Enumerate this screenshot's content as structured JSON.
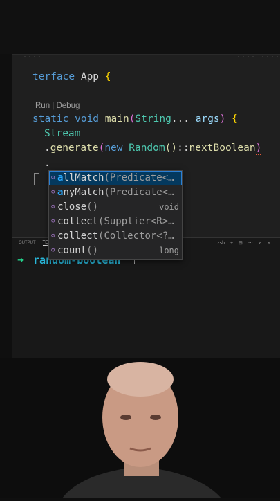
{
  "editor": {
    "tab_marks": [
      "....",
      "....",
      "...."
    ],
    "lines": {
      "l1_kw": "terface",
      "l1_name": " App ",
      "l1_brace": "{",
      "codelens": "Run | Debug",
      "l2_kw1": "static void",
      "l2_fn": " main",
      "l2_paren_open": "(",
      "l2_type": "String",
      "l2_rest": "... ",
      "l2_arg": "args",
      "l2_paren_close": ")",
      "l2_brace": " {",
      "l3_type": "Stream",
      "l4_dot": ".",
      "l4_fn": "generate",
      "l4_paren_open": "(",
      "l4_kw": "new",
      "l4_type": " Random",
      "l4_call": "()",
      "l4_sep": "::",
      "l4_fn2": "nextBoolean",
      "l4_paren_close": ")",
      "l5_dot": "."
    }
  },
  "suggestions": [
    {
      "match": "a",
      "name": "llMatch",
      "sig": "(Predicate<…",
      "ret": "",
      "selected": true
    },
    {
      "match": "a",
      "name": "nyMatch",
      "sig": "(Predicate<…",
      "ret": ""
    },
    {
      "match": "",
      "name": "close",
      "sig": "()",
      "ret": "void"
    },
    {
      "match": "",
      "name": "collect",
      "sig": "(Supplier<R>…",
      "ret": ""
    },
    {
      "match": "",
      "name": "collect",
      "sig": "(Collector<?…",
      "ret": ""
    },
    {
      "match": "",
      "name": "count",
      "sig": "()",
      "ret": "long"
    }
  ],
  "panel": {
    "tabs": [
      "OUTPUT",
      "TERMI"
    ],
    "shell": "zsh",
    "controls": [
      "+",
      "⊟",
      "⋯",
      "∧",
      "×"
    ]
  },
  "terminal": {
    "prompt_arrow": "➜",
    "directory": "random-boolean"
  }
}
